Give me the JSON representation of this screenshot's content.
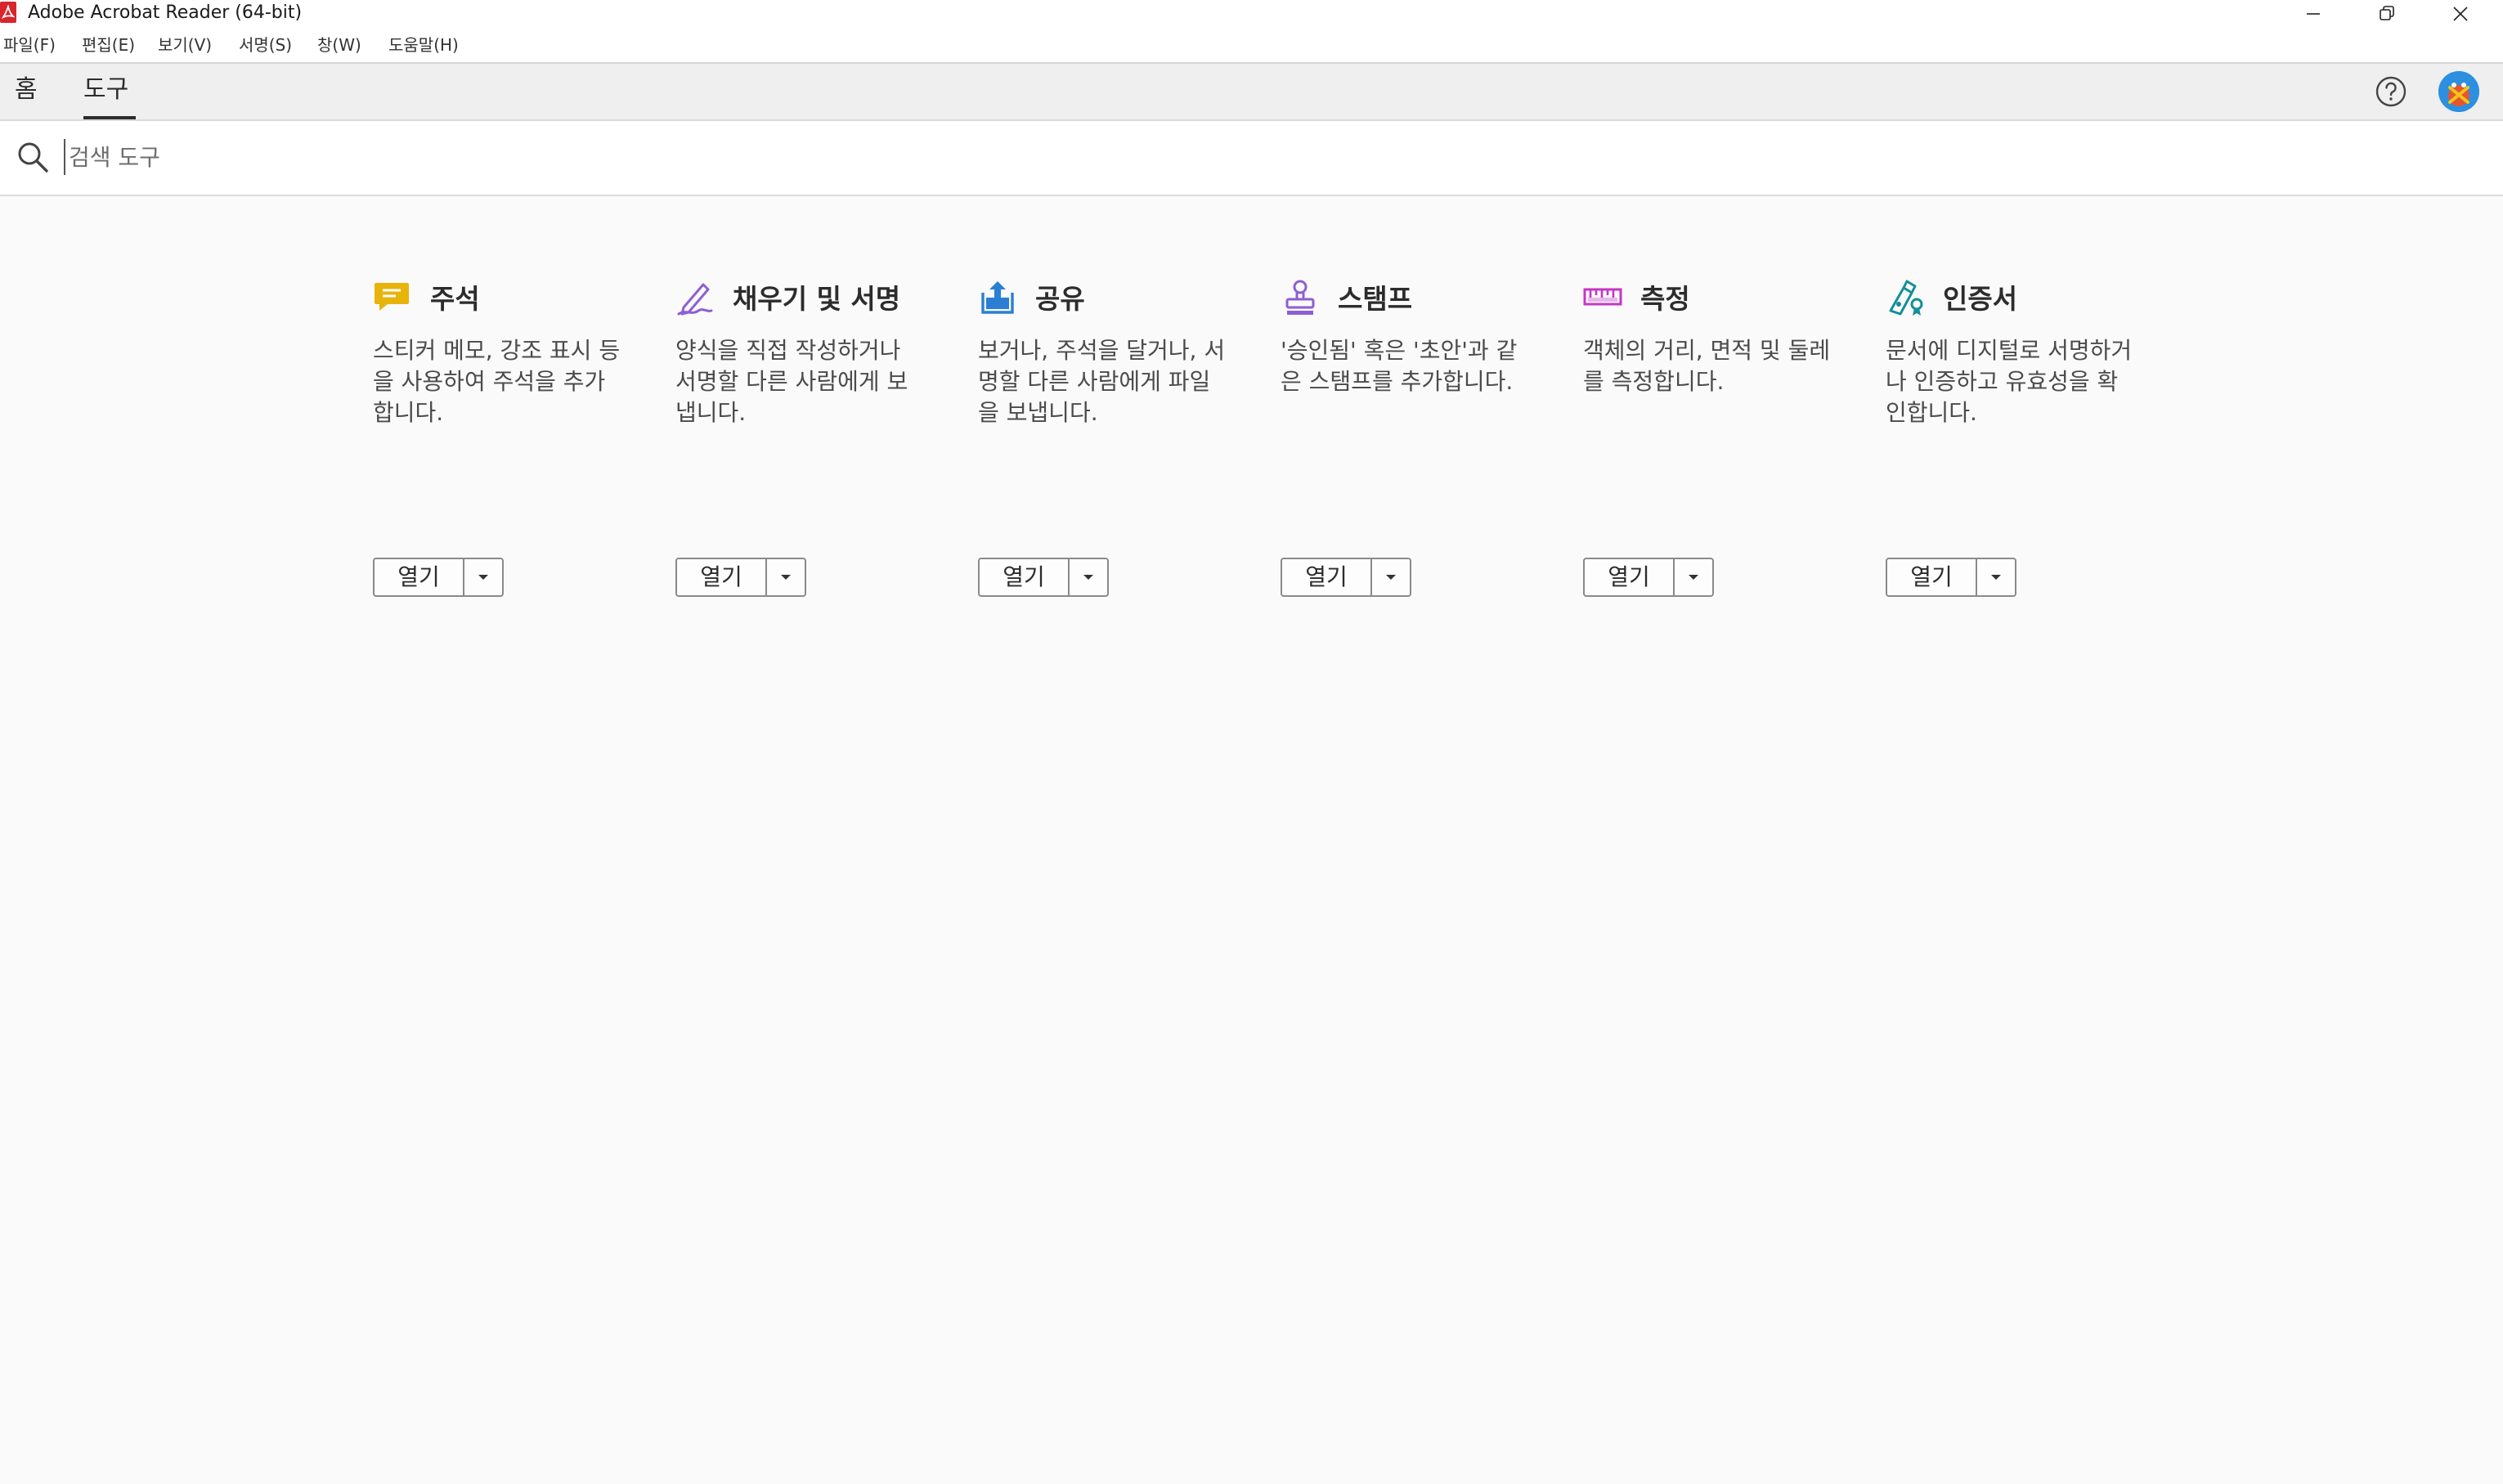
{
  "window": {
    "title": "Adobe Acrobat Reader (64-bit)"
  },
  "menu": {
    "items": [
      "파일(F)",
      "편집(E)",
      "보기(V)",
      "서명(S)",
      "창(W)",
      "도움말(H)"
    ]
  },
  "tabs": {
    "home": "홈",
    "tools": "도구",
    "active": "tools"
  },
  "search": {
    "placeholder": "검색 도구",
    "value": ""
  },
  "tools": [
    {
      "title": "주석",
      "description": "스티커 메모, 강조 표시 등을 사용하여 주석을 추가합니다.",
      "open_label": "열기",
      "icon": "comment-icon",
      "color": "#e8b40c"
    },
    {
      "title": "채우기 및 서명",
      "description": "양식을 직접 작성하거나 서명할 다른 사람에게 보냅니다.",
      "open_label": "열기",
      "icon": "fill-sign-icon",
      "color": "#8d5fd3"
    },
    {
      "title": "공유",
      "description": "보거나, 주석을 달거나, 서명할 다른 사람에게 파일을 보냅니다.",
      "open_label": "열기",
      "icon": "share-icon",
      "color": "#2a7fd4"
    },
    {
      "title": "스탬프",
      "description": "'승인됨' 혹은 '초안'과 같은 스탬프를 추가합니다.",
      "open_label": "열기",
      "icon": "stamp-icon",
      "color": "#8d5fd3"
    },
    {
      "title": "측정",
      "description": "객체의 거리, 면적 및 둘레를 측정합니다.",
      "open_label": "열기",
      "icon": "ruler-icon",
      "color": "#c635c7"
    },
    {
      "title": "인증서",
      "description": "문서에 디지털로 서명하거나 인증하고 유효성을 확인합니다.",
      "open_label": "열기",
      "icon": "certificate-icon",
      "color": "#138f9a"
    }
  ]
}
